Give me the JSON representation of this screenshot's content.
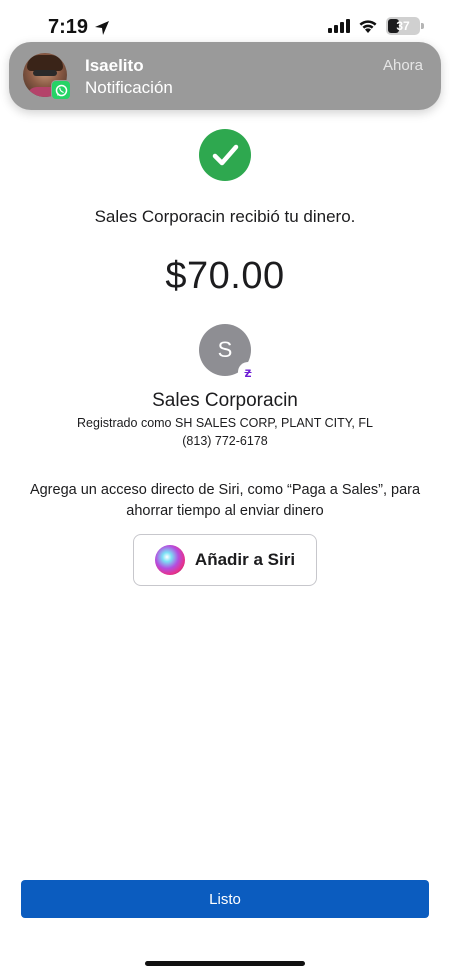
{
  "status_bar": {
    "time": "7:19",
    "battery_level": "37",
    "battery_fraction": 0.37
  },
  "notification": {
    "sender": "Isaelito",
    "body": "Notificación",
    "time": "Ahora",
    "app_icon": "whatsapp-icon"
  },
  "confirmation": {
    "icon": "checkmark-icon",
    "message": "Sales Corporacin recibió tu dinero.",
    "amount": "$70.00"
  },
  "recipient": {
    "initial": "S",
    "badge": "z",
    "name": "Sales Corporacin",
    "registered_as": "Registrado como SH SALES CORP, PLANT CITY, FL",
    "phone": "(813) 772-6178"
  },
  "siri": {
    "prompt": "Agrega un acceso directo de Siri, como “Paga a Sales”, para ahorrar tiempo al enviar dinero",
    "button_label": "Añadir a Siri"
  },
  "footer": {
    "done_label": "Listo"
  },
  "colors": {
    "success_green": "#2ea84f",
    "primary_blue": "#0b5cbf",
    "zelle_purple": "#6d1ed4",
    "notification_gray": "#9a9a9a"
  }
}
